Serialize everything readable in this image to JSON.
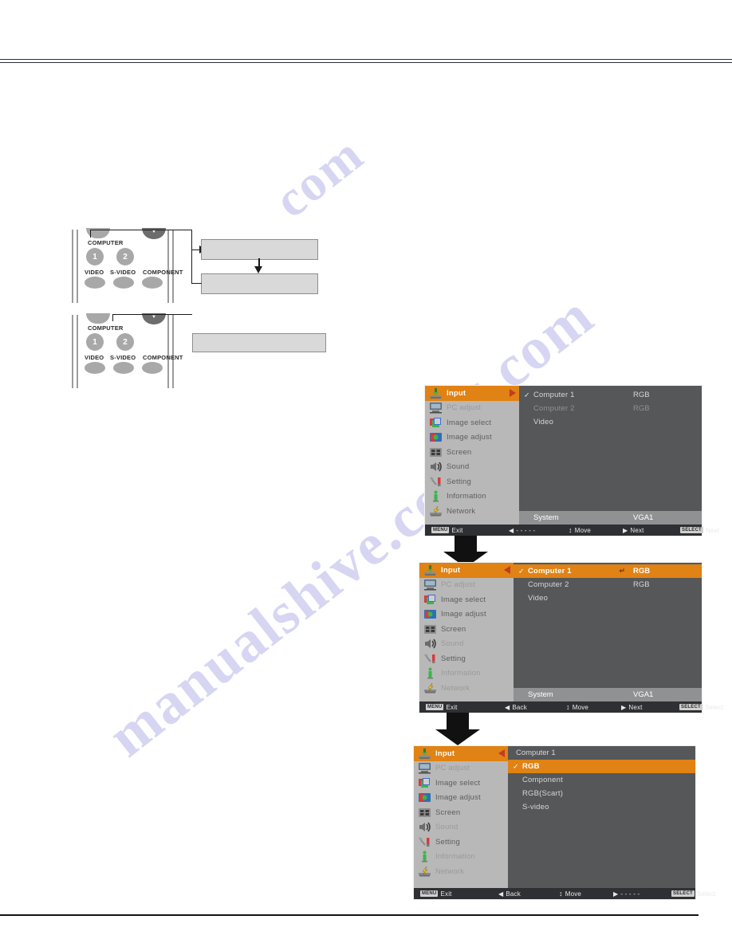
{
  "page": {
    "watermarks": [
      "manualshive.com",
      "s.com",
      "com"
    ]
  },
  "remotes": [
    {
      "id": "remote-computer1",
      "label_computer": "COMPUTER",
      "buttons": [
        {
          "name": "computer-1",
          "label": "1"
        },
        {
          "name": "computer-2",
          "label": "2"
        },
        {
          "name": "video",
          "label": "VIDEO"
        },
        {
          "name": "s-video",
          "label": "S-VIDEO"
        },
        {
          "name": "component",
          "label": "COMPONENT"
        }
      ],
      "callout_boxes": [
        {
          "name": "callout-box-top",
          "text": ""
        },
        {
          "name": "callout-box-bottom",
          "text": ""
        }
      ]
    },
    {
      "id": "remote-computer2",
      "label_computer": "COMPUTER",
      "buttons": [
        {
          "name": "computer-1",
          "label": "1"
        },
        {
          "name": "computer-2",
          "label": "2"
        },
        {
          "name": "video",
          "label": "VIDEO"
        },
        {
          "name": "s-video",
          "label": "S-VIDEO"
        },
        {
          "name": "component",
          "label": "COMPONENT"
        }
      ],
      "callout_boxes": [
        {
          "name": "callout-box-single",
          "text": ""
        }
      ]
    }
  ],
  "osd": {
    "menu_items": [
      {
        "label": "Input",
        "icon": "input-icon"
      },
      {
        "label": "PC adjust",
        "icon": "pc-adjust-icon"
      },
      {
        "label": "Image select",
        "icon": "image-select-icon"
      },
      {
        "label": "Image adjust",
        "icon": "image-adjust-icon"
      },
      {
        "label": "Screen",
        "icon": "screen-icon"
      },
      {
        "label": "Sound",
        "icon": "sound-icon"
      },
      {
        "label": "Setting",
        "icon": "setting-icon"
      },
      {
        "label": "Information",
        "icon": "information-icon"
      },
      {
        "label": "Network",
        "icon": "network-icon"
      }
    ],
    "panel1": {
      "name": "input-menu-step1",
      "options": [
        {
          "label": "Computer 1",
          "value": "RGB",
          "checked": true,
          "dim": false
        },
        {
          "label": "Computer 2",
          "value": "RGB",
          "checked": false,
          "dim": true
        },
        {
          "label": "Video",
          "value": "",
          "checked": false,
          "dim": false
        }
      ],
      "system": {
        "label": "System",
        "value": "VGA1"
      },
      "keybar": [
        {
          "badge": "MENU",
          "text": "Exit"
        },
        {
          "badge": "",
          "text": "- - - - -",
          "glyph": "left"
        },
        {
          "badge": "",
          "text": "Move",
          "glyph": "updown"
        },
        {
          "badge": "",
          "text": "Next",
          "glyph": "right"
        },
        {
          "badge": "SELECT",
          "text": "Next"
        }
      ]
    },
    "panel2": {
      "name": "input-menu-step2",
      "options": [
        {
          "label": "Computer 1",
          "value": "RGB",
          "checked": true,
          "highlight": true
        },
        {
          "label": "Computer 2",
          "value": "RGB",
          "checked": false,
          "highlight": false
        },
        {
          "label": "Video",
          "value": "",
          "checked": false,
          "highlight": false
        }
      ],
      "system": {
        "label": "System",
        "value": "VGA1"
      },
      "keybar": [
        {
          "badge": "MENU",
          "text": "Exit"
        },
        {
          "badge": "",
          "text": "Back",
          "glyph": "left"
        },
        {
          "badge": "",
          "text": "Move",
          "glyph": "updown"
        },
        {
          "badge": "",
          "text": "Next",
          "glyph": "right"
        },
        {
          "badge": "SELECT",
          "text": "Select"
        }
      ]
    },
    "panel3": {
      "name": "input-source-submenu",
      "title": "Computer 1",
      "options": [
        {
          "label": "RGB",
          "checked": true,
          "highlight": true
        },
        {
          "label": "Component",
          "checked": false,
          "highlight": false
        },
        {
          "label": "RGB(Scart)",
          "checked": false,
          "highlight": false
        },
        {
          "label": "S-video",
          "checked": false,
          "highlight": false
        }
      ],
      "keybar": [
        {
          "badge": "MENU",
          "text": "Exit"
        },
        {
          "badge": "",
          "text": "Back",
          "glyph": "left"
        },
        {
          "badge": "",
          "text": "Move",
          "glyph": "updown"
        },
        {
          "badge": "",
          "text": "- - - - -",
          "glyph": "right"
        },
        {
          "badge": "SELECT",
          "text": "Select"
        }
      ]
    }
  }
}
